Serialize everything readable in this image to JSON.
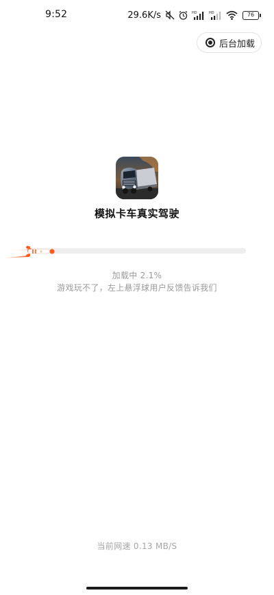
{
  "status_bar": {
    "time": "9:52",
    "network_speed": "29.6K/s",
    "battery_level": "76",
    "icons": [
      "mute-icon",
      "alarm-icon",
      "hd-signal-icon",
      "hd-signal-icon",
      "wifi-icon",
      "battery-icon"
    ]
  },
  "background_load": {
    "label": "后台加载",
    "icon": "target-icon"
  },
  "game": {
    "title": "模拟卡车真实驾驶",
    "icon": "truck-game-icon"
  },
  "progress": {
    "status_prefix": "加载中",
    "percent_text": "2.1%",
    "percent": 2.1,
    "accent_color": "#ff5a1f",
    "feedback_tip": "游戏玩不了，左上悬浮球用户反馈告诉我们"
  },
  "footer": {
    "speed_label": "当前网速",
    "speed_value": "0.13 MB/S"
  }
}
